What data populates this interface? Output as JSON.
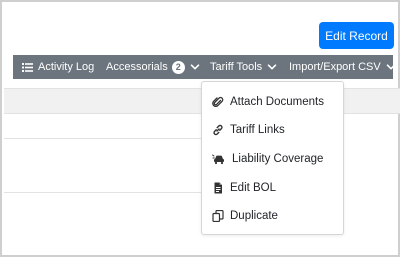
{
  "header": {
    "edit_record_label": "Edit Record"
  },
  "toolbar": {
    "activity_log": {
      "label": "Activity Log",
      "icon": "list-icon"
    },
    "accessorials": {
      "label": "Accessorials",
      "badge": "2",
      "icon": "chevron-down-icon"
    },
    "tariff_tools": {
      "label": "Tariff Tools",
      "icon": "chevron-down-icon"
    },
    "import_export": {
      "label": "Import/Export CSV",
      "icon": "chevron-down-icon"
    }
  },
  "dropdown": {
    "items": [
      {
        "label": "Attach Documents",
        "icon": "paperclip-icon"
      },
      {
        "label": "Tariff Links",
        "icon": "link-icon"
      },
      {
        "label": "Liability Coverage",
        "icon": "car-crash-icon"
      },
      {
        "label": "Edit BOL",
        "icon": "file-icon"
      },
      {
        "label": "Duplicate",
        "icon": "copy-icon"
      }
    ]
  },
  "colors": {
    "primary": "#007bff",
    "toolbar": "#6c757d",
    "text": "#212529"
  }
}
